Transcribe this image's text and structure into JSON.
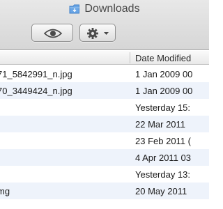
{
  "window": {
    "title": "Downloads"
  },
  "toolbar": {
    "quicklook_icon": "eye-icon",
    "action_icon": "gear-icon",
    "action_menu_icon": "chevron-down-icon"
  },
  "columns": {
    "date_modified": "Date Modified"
  },
  "files": [
    {
      "name": "71_5842991_n.jpg",
      "date": "1 Jan 2009 00"
    },
    {
      "name": "70_3449424_n.jpg",
      "date": "1 Jan 2009 00"
    },
    {
      "name": "",
      "date": "Yesterday 15:"
    },
    {
      "name": "",
      "date": "22 Mar 2011"
    },
    {
      "name": "",
      "date": "23 Feb 2011 ("
    },
    {
      "name": "",
      "date": "4 Apr 2011 03"
    },
    {
      "name": "",
      "date": "Yesterday 13:"
    },
    {
      "name": "mg",
      "date": "20 May 2011"
    }
  ],
  "colors": {
    "folder_blue": "#6aa6e6",
    "row_stripe": "#eef3fb"
  }
}
